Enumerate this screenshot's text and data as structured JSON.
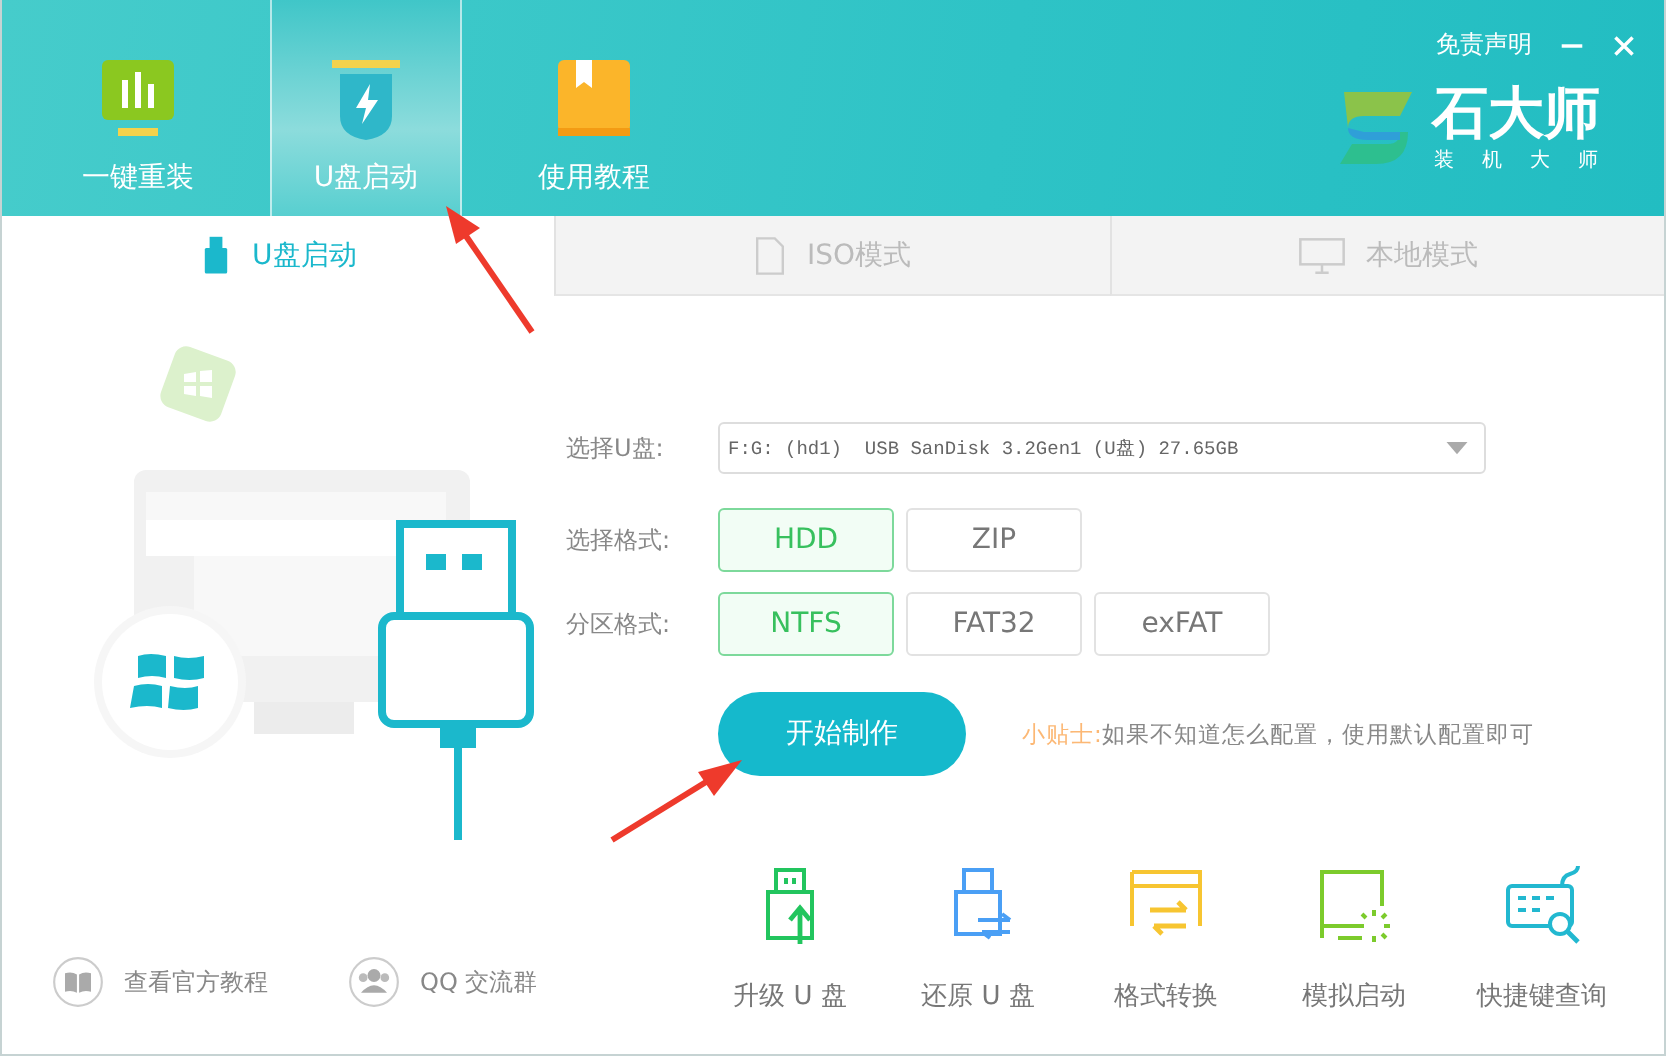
{
  "header": {
    "nav": [
      {
        "label": "一键重装",
        "kind": "chart",
        "selected": false
      },
      {
        "label": "U盘启动",
        "kind": "shield",
        "selected": true
      },
      {
        "label": "使用教程",
        "kind": "book",
        "selected": false
      }
    ],
    "disclaimer": "免责声明",
    "logo": {
      "name": "石大师",
      "tagline": "装机大师"
    }
  },
  "mode_tabs": [
    {
      "label": "U盘启动",
      "kind": "usb",
      "selected": true
    },
    {
      "label": "ISO模式",
      "kind": "iso",
      "selected": false
    },
    {
      "label": "本地模式",
      "kind": "monitor",
      "selected": false
    }
  ],
  "form": {
    "drive_label": "选择U盘:",
    "drive_value": "F:G: (hd1)  USB SanDisk 3.2Gen1 (U盘) 27.65GB",
    "format_label": "选择格式:",
    "formats": [
      {
        "label": "HDD",
        "selected": true
      },
      {
        "label": "ZIP",
        "selected": false
      }
    ],
    "partition_label": "分区格式:",
    "partitions": [
      {
        "label": "NTFS",
        "selected": true
      },
      {
        "label": "FAT32",
        "selected": false
      },
      {
        "label": "exFAT",
        "selected": false
      }
    ],
    "start_button": "开始制作",
    "tip_label": "小贴士:",
    "tip_text": "如果不知道怎么配置，使用默认配置即可"
  },
  "links": [
    {
      "label": "查看官方教程",
      "kind": "book"
    },
    {
      "label": "QQ 交流群",
      "kind": "people"
    }
  ],
  "tools": [
    {
      "label": "升级 U 盘",
      "kind": "upgrade"
    },
    {
      "label": "还原 U 盘",
      "kind": "restore"
    },
    {
      "label": "格式转换",
      "kind": "convert"
    },
    {
      "label": "模拟启动",
      "kind": "simulate"
    },
    {
      "label": "快捷键查询",
      "kind": "hotkey"
    }
  ]
}
